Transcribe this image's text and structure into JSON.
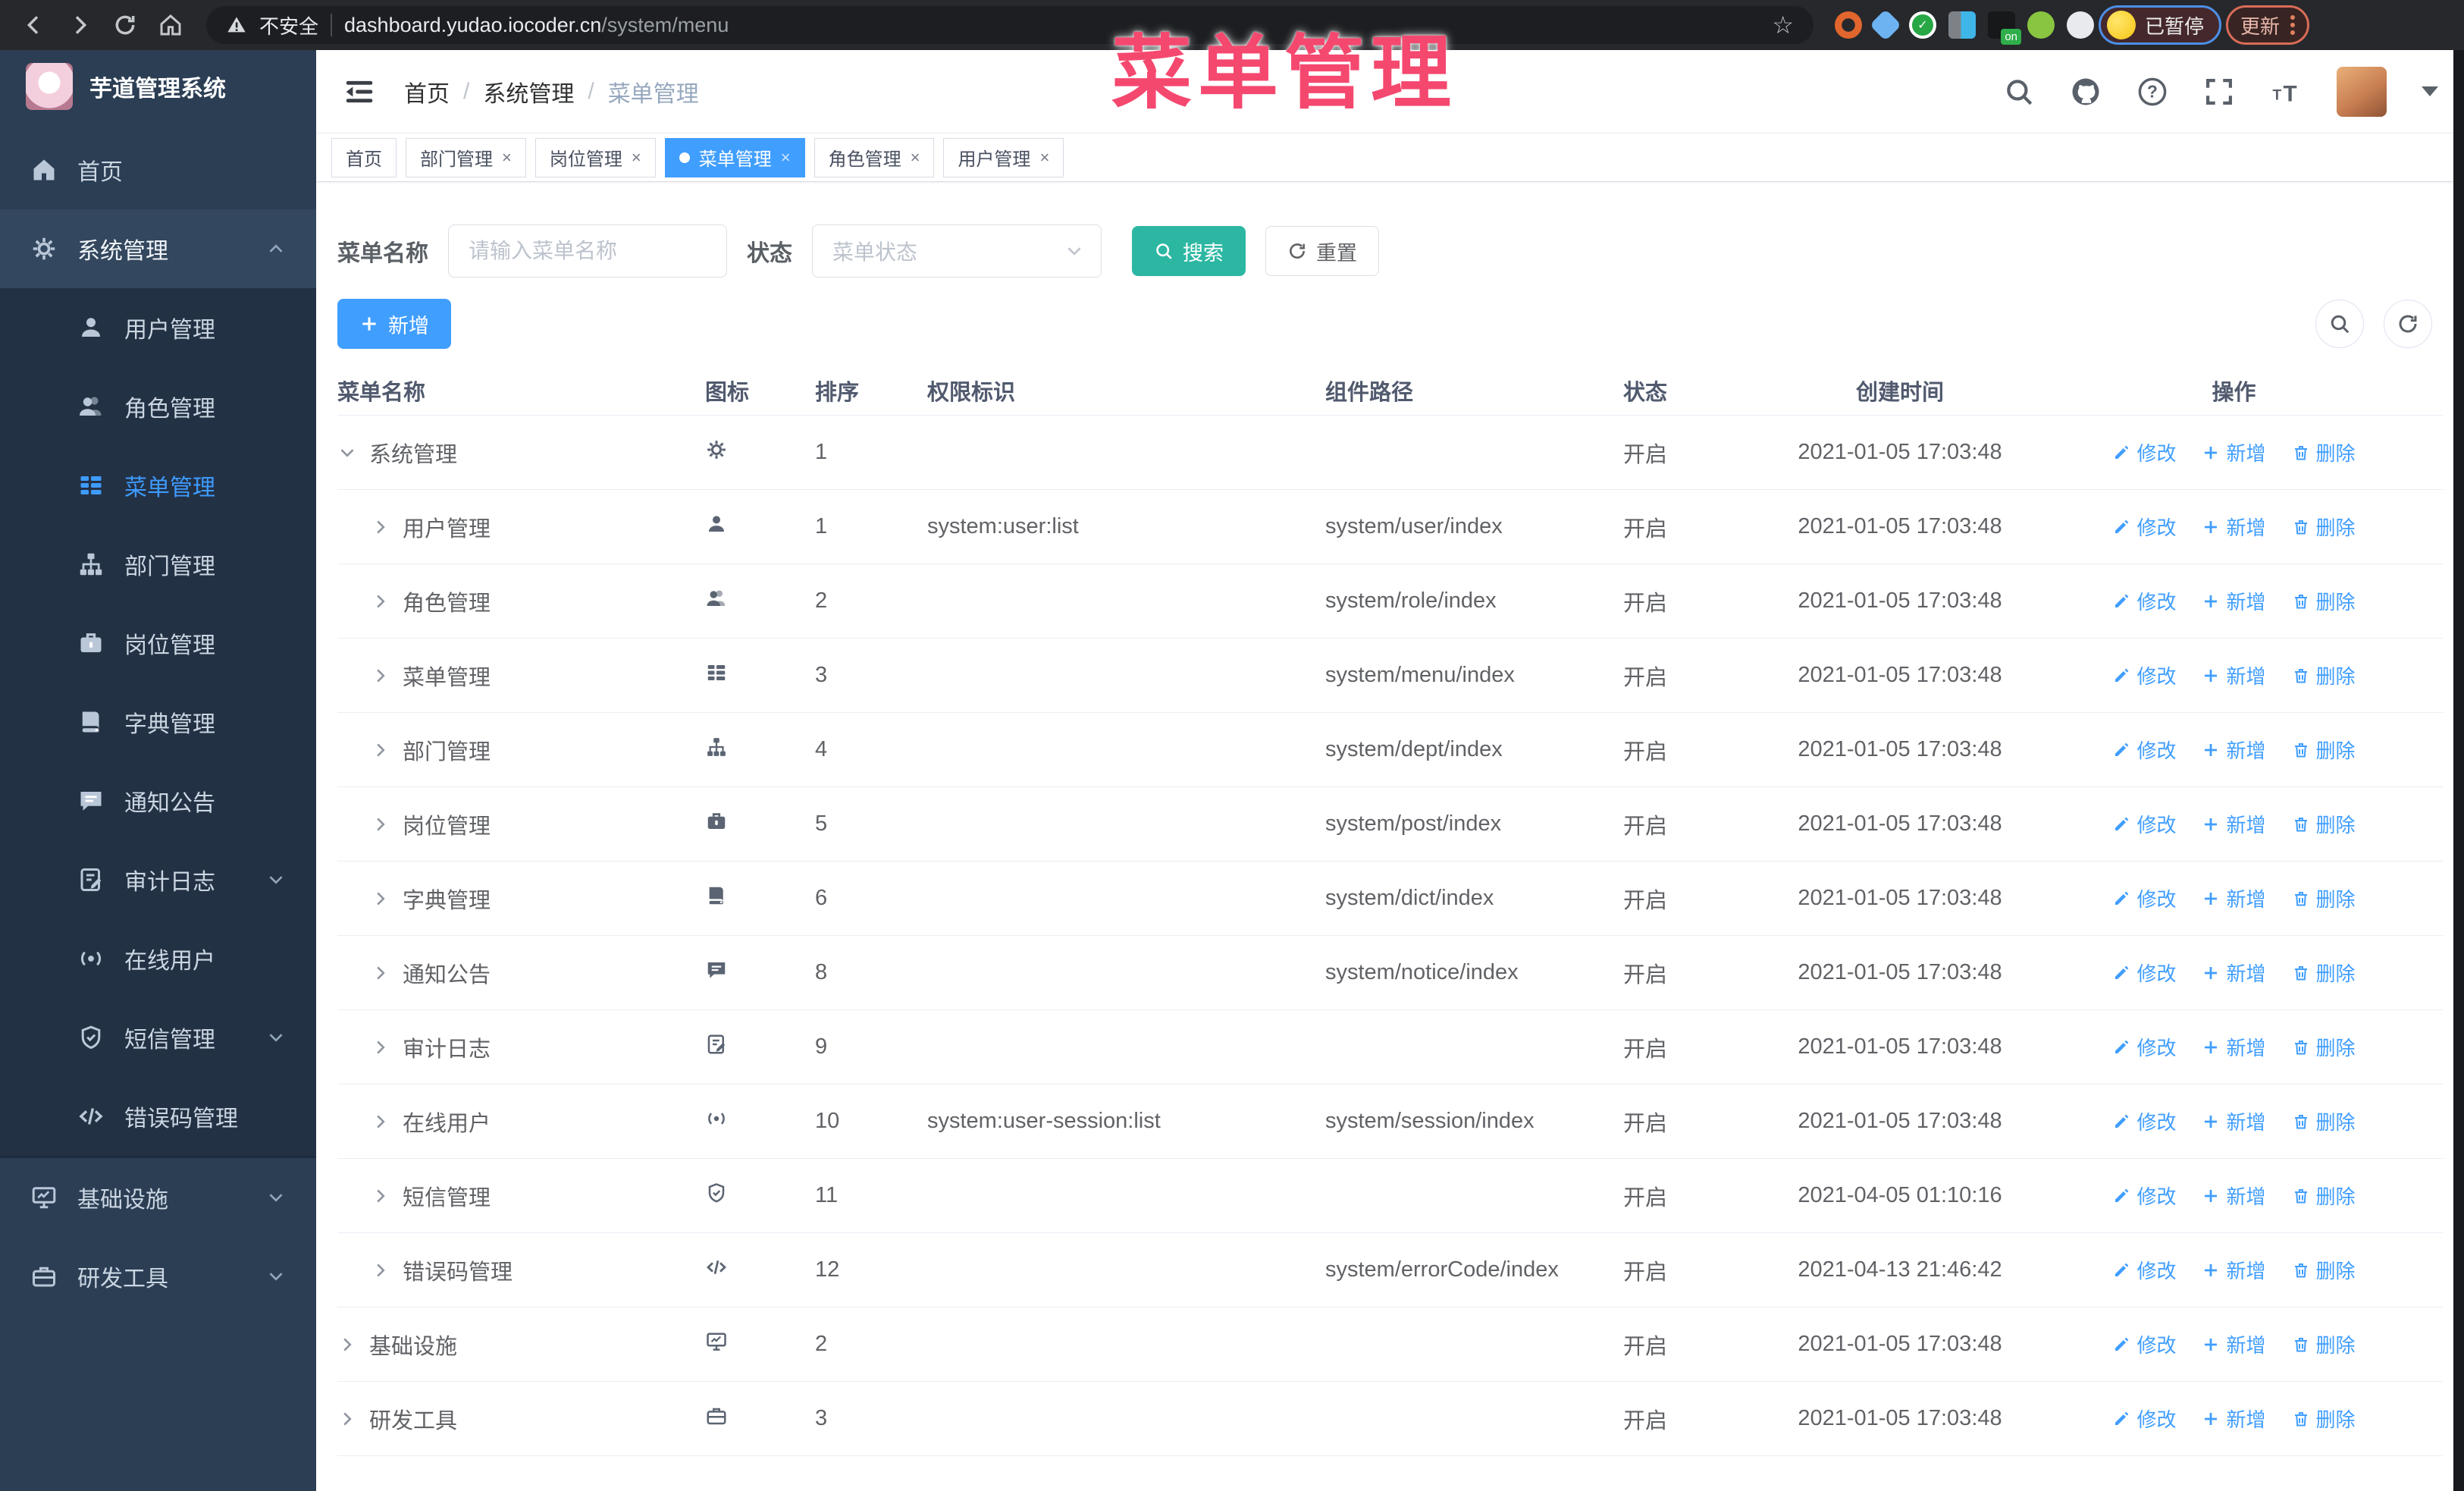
{
  "watermark": "菜单管理",
  "browser": {
    "security_label": "不安全",
    "url_domain": "dashboard.yudao.iocoder.cn",
    "url_path": "/system/menu",
    "paused_label": "已暂停",
    "update_label": "更新",
    "ext_on_label": "on",
    "nav_icons": [
      "back",
      "forward",
      "reload",
      "home"
    ],
    "extension_icons": [
      "orange-ring",
      "blue-gem",
      "green-shield",
      "panel",
      "terminal-on-badge",
      "android-figure",
      "puzzle"
    ]
  },
  "sidebar": {
    "logo_title": "芋道管理系统",
    "items": [
      {
        "label": "首页",
        "icon": "home",
        "type": "top"
      },
      {
        "label": "系统管理",
        "icon": "gear",
        "type": "top",
        "parent_active": true,
        "chevron": "up"
      },
      {
        "label": "用户管理",
        "icon": "user",
        "type": "sub"
      },
      {
        "label": "角色管理",
        "icon": "users",
        "type": "sub"
      },
      {
        "label": "菜单管理",
        "icon": "menu",
        "type": "sub",
        "active": true
      },
      {
        "label": "部门管理",
        "icon": "dept",
        "type": "sub"
      },
      {
        "label": "岗位管理",
        "icon": "post",
        "type": "sub"
      },
      {
        "label": "字典管理",
        "icon": "dict",
        "type": "sub"
      },
      {
        "label": "通知公告",
        "icon": "notice",
        "type": "sub"
      },
      {
        "label": "审计日志",
        "icon": "log",
        "type": "sub",
        "chevron": "down"
      },
      {
        "label": "在线用户",
        "icon": "online",
        "type": "sub"
      },
      {
        "label": "短信管理",
        "icon": "sms",
        "type": "sub",
        "chevron": "down"
      },
      {
        "label": "错误码管理",
        "icon": "code",
        "type": "sub"
      },
      {
        "divider": true
      },
      {
        "label": "基础设施",
        "icon": "monitor",
        "type": "top",
        "chevron": "down"
      },
      {
        "label": "研发工具",
        "icon": "tool",
        "type": "top",
        "chevron": "down"
      }
    ]
  },
  "header": {
    "breadcrumb": [
      "首页",
      "系统管理",
      "菜单管理"
    ],
    "icons": [
      "search",
      "github",
      "help",
      "fullscreen",
      "font-size",
      "avatar",
      "caret-down"
    ]
  },
  "tabs": [
    {
      "label": "首页",
      "closable": false,
      "active": false
    },
    {
      "label": "部门管理",
      "closable": true,
      "active": false
    },
    {
      "label": "岗位管理",
      "closable": true,
      "active": false
    },
    {
      "label": "菜单管理",
      "closable": true,
      "active": true
    },
    {
      "label": "角色管理",
      "closable": true,
      "active": false
    },
    {
      "label": "用户管理",
      "closable": true,
      "active": false
    }
  ],
  "filters": {
    "name_label": "菜单名称",
    "name_placeholder": "请输入菜单名称",
    "status_label": "状态",
    "status_placeholder": "菜单状态",
    "search_label": "搜索",
    "reset_label": "重置"
  },
  "toolbar": {
    "add_label": "新增"
  },
  "table": {
    "columns": [
      "菜单名称",
      "图标",
      "排序",
      "权限标识",
      "组件路径",
      "状态",
      "创建时间",
      "操作"
    ],
    "op_labels": [
      "修改",
      "新增",
      "删除"
    ],
    "rows": [
      {
        "name": "系统管理",
        "icon": "gear",
        "level": 0,
        "expand": "down",
        "sort": "1",
        "perm": "",
        "path": "",
        "status": "开启",
        "time": "2021-01-05 17:03:48"
      },
      {
        "name": "用户管理",
        "icon": "user",
        "level": 1,
        "expand": "right",
        "sort": "1",
        "perm": "system:user:list",
        "path": "system/user/index",
        "status": "开启",
        "time": "2021-01-05 17:03:48"
      },
      {
        "name": "角色管理",
        "icon": "users",
        "level": 1,
        "expand": "right",
        "sort": "2",
        "perm": "",
        "path": "system/role/index",
        "status": "开启",
        "time": "2021-01-05 17:03:48"
      },
      {
        "name": "菜单管理",
        "icon": "menu",
        "level": 1,
        "expand": "right",
        "sort": "3",
        "perm": "",
        "path": "system/menu/index",
        "status": "开启",
        "time": "2021-01-05 17:03:48"
      },
      {
        "name": "部门管理",
        "icon": "dept",
        "level": 1,
        "expand": "right",
        "sort": "4",
        "perm": "",
        "path": "system/dept/index",
        "status": "开启",
        "time": "2021-01-05 17:03:48"
      },
      {
        "name": "岗位管理",
        "icon": "post",
        "level": 1,
        "expand": "right",
        "sort": "5",
        "perm": "",
        "path": "system/post/index",
        "status": "开启",
        "time": "2021-01-05 17:03:48"
      },
      {
        "name": "字典管理",
        "icon": "dict",
        "level": 1,
        "expand": "right",
        "sort": "6",
        "perm": "",
        "path": "system/dict/index",
        "status": "开启",
        "time": "2021-01-05 17:03:48"
      },
      {
        "name": "通知公告",
        "icon": "notice",
        "level": 1,
        "expand": "right",
        "sort": "8",
        "perm": "",
        "path": "system/notice/index",
        "status": "开启",
        "time": "2021-01-05 17:03:48"
      },
      {
        "name": "审计日志",
        "icon": "log",
        "level": 1,
        "expand": "right",
        "sort": "9",
        "perm": "",
        "path": "",
        "status": "开启",
        "time": "2021-01-05 17:03:48"
      },
      {
        "name": "在线用户",
        "icon": "online",
        "level": 1,
        "expand": "right",
        "sort": "10",
        "perm": "system:user-session:list",
        "path": "system/session/index",
        "status": "开启",
        "time": "2021-01-05 17:03:48"
      },
      {
        "name": "短信管理",
        "icon": "sms",
        "level": 1,
        "expand": "right",
        "sort": "11",
        "perm": "",
        "path": "",
        "status": "开启",
        "time": "2021-04-05 01:10:16"
      },
      {
        "name": "错误码管理",
        "icon": "code",
        "level": 1,
        "expand": "right",
        "sort": "12",
        "perm": "",
        "path": "system/errorCode/index",
        "status": "开启",
        "time": "2021-04-13 21:46:42"
      },
      {
        "name": "基础设施",
        "icon": "monitor",
        "level": 0,
        "expand": "right",
        "sort": "2",
        "perm": "",
        "path": "",
        "status": "开启",
        "time": "2021-01-05 17:03:48"
      },
      {
        "name": "研发工具",
        "icon": "tool",
        "level": 0,
        "expand": "right",
        "sort": "3",
        "perm": "",
        "path": "",
        "status": "开启",
        "time": "2021-01-05 17:03:48"
      }
    ]
  }
}
